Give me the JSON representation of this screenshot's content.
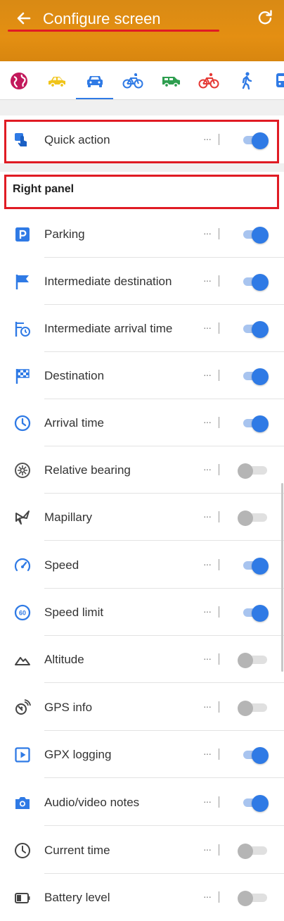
{
  "header": {
    "title": "Configure screen",
    "back_icon": "arrow-left-icon",
    "reset_icon": "refresh-icon",
    "background_color": "#e08e12"
  },
  "profiles": [
    {
      "name": "browse-map",
      "icon": "globe-icon",
      "color": "#c2185b"
    },
    {
      "name": "car-yellow",
      "icon": "car-icon",
      "color": "#f0c419"
    },
    {
      "name": "car",
      "icon": "car-icon",
      "color": "#2f7ae5",
      "selected": true
    },
    {
      "name": "bicycle",
      "icon": "bicycle-icon",
      "color": "#2f7ae5"
    },
    {
      "name": "van",
      "icon": "van-icon",
      "color": "#2e9e4f"
    },
    {
      "name": "bicycle-red",
      "icon": "bicycle-icon",
      "color": "#e53935"
    },
    {
      "name": "pedestrian",
      "icon": "walking-icon",
      "color": "#2f7ae5"
    },
    {
      "name": "bus",
      "icon": "bus-icon",
      "color": "#2f7ae5"
    }
  ],
  "quick_action": {
    "label": "Quick action",
    "more": "···",
    "enabled": true
  },
  "right_panel": {
    "title": "Right panel",
    "items": [
      {
        "label": "Parking",
        "icon": "parking-icon",
        "enabled": true
      },
      {
        "label": "Intermediate destination",
        "icon": "flag-icon",
        "enabled": true
      },
      {
        "label": "Intermediate arrival time",
        "icon": "flag-clock-icon",
        "enabled": true
      },
      {
        "label": "Destination",
        "icon": "checkered-flag-icon",
        "enabled": true
      },
      {
        "label": "Arrival time",
        "icon": "clock-icon",
        "enabled": true
      },
      {
        "label": "Relative bearing",
        "icon": "compass-icon",
        "enabled": false
      },
      {
        "label": "Mapillary",
        "icon": "mapillary-icon",
        "enabled": false
      },
      {
        "label": "Speed",
        "icon": "speedometer-icon",
        "enabled": true
      },
      {
        "label": "Speed limit",
        "icon": "speed-limit-icon",
        "enabled": true
      },
      {
        "label": "Altitude",
        "icon": "mountain-icon",
        "enabled": false
      },
      {
        "label": "GPS info",
        "icon": "satellite-icon",
        "enabled": false
      },
      {
        "label": "GPX logging",
        "icon": "gpx-record-icon",
        "enabled": true
      },
      {
        "label": "Audio/video notes",
        "icon": "camera-icon",
        "enabled": true
      },
      {
        "label": "Current time",
        "icon": "clock-outline-icon",
        "enabled": false
      },
      {
        "label": "Battery level",
        "icon": "battery-icon",
        "enabled": false
      }
    ]
  },
  "more_label": "···",
  "colors": {
    "accent": "#2f7ae5",
    "highlight": "#e01b24",
    "toggle_off": "#b5b5b5"
  }
}
